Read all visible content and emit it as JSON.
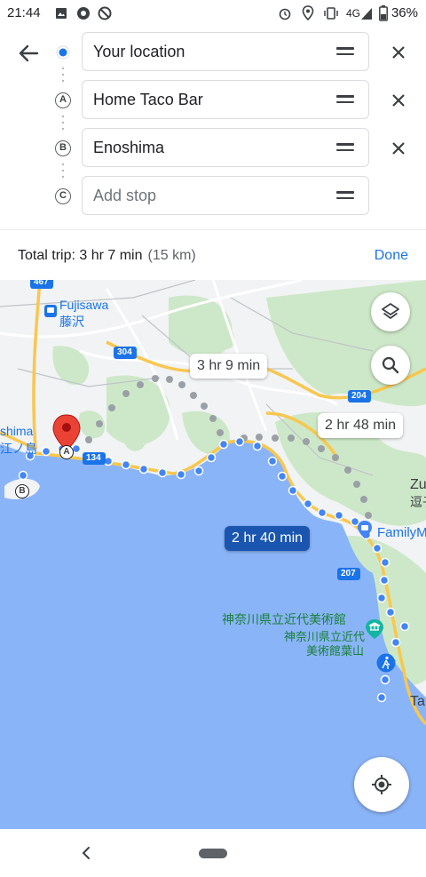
{
  "status": {
    "time": "21:44",
    "network": "4G",
    "battery": "36%"
  },
  "route": {
    "origin": "Your location",
    "stop_a": "Home Taco Bar",
    "stop_b": "Enoshima",
    "add_stop_placeholder": "Add stop",
    "marker_a": "A",
    "marker_b": "B",
    "marker_c": "C"
  },
  "trip": {
    "summary": "Total trip: 3 hr 7 min",
    "distance": "(15 km)",
    "done_label": "Done"
  },
  "map": {
    "chips": [
      "3 hr 9 min",
      "2 hr 48 min",
      "2 hr 40 min"
    ],
    "labels": {
      "fujisawa_en": "Fujisawa",
      "fujisawa_jp": "藤沢",
      "enoshima_partial": "shima",
      "enoshima_jp_partial": "江ノ島",
      "zushi_partial": "Zu",
      "zushi_jp_partial": "逗子",
      "familymart": "FamilyM",
      "museum_large": "神奈川県立近代美術館",
      "museum_small_1": "神奈川県立近代",
      "museum_small_2": "美術館葉山",
      "ta_partial": "Ta"
    },
    "road_shields": [
      "467",
      "304",
      "134",
      "204",
      "207"
    ],
    "marker_a": "A",
    "marker_b": "B"
  },
  "icons": [
    "back-arrow-icon",
    "drag-handle-icon",
    "close-icon",
    "layers-icon",
    "search-icon",
    "my-location-icon",
    "nav-back-icon",
    "home-pill-icon",
    "walk-icon",
    "museum-icon",
    "shop-icon",
    "train-icon"
  ],
  "colors": {
    "accent": "#1a73e8",
    "route_selected": "#1a56b0",
    "sea": "#8ab4f8",
    "pin": "#ea4335"
  }
}
